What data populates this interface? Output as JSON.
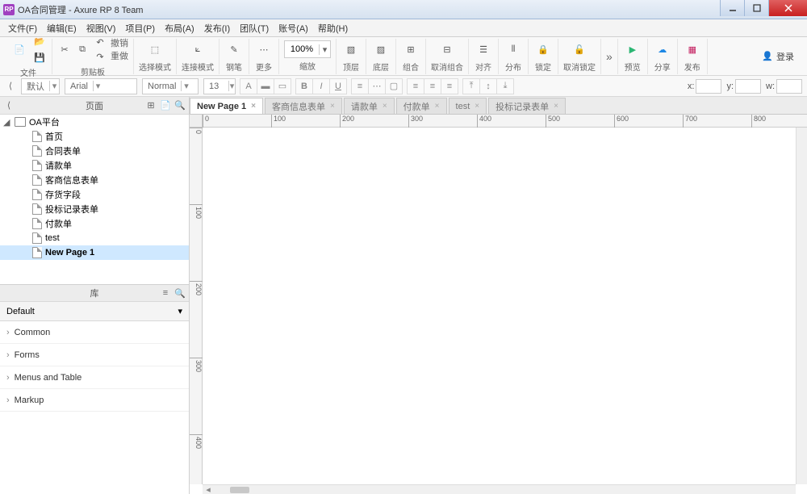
{
  "title": "OA合同管理 - Axure RP 8 Team",
  "appicon_text": "RP",
  "menu": [
    "文件(F)",
    "编辑(E)",
    "视图(V)",
    "项目(P)",
    "布局(A)",
    "发布(I)",
    "团队(T)",
    "账号(A)",
    "帮助(H)"
  ],
  "toolbar": {
    "file": "文件",
    "clipboard": "剪贴板",
    "undo": "撤销",
    "redo": "重做",
    "select_mode": "选择模式",
    "connect_mode": "连接模式",
    "pen": "钢笔",
    "more": "更多",
    "zoom": "100%",
    "scale": "缩放",
    "top": "顶层",
    "bottom": "底层",
    "group": "组合",
    "ungroup": "取消组合",
    "align": "对齐",
    "distribute": "分布",
    "lock": "锁定",
    "unlock": "取消锁定",
    "expand": "»",
    "preview": "预览",
    "share": "分享",
    "publish": "发布",
    "login": "登录"
  },
  "format": {
    "style": "默认",
    "font": "Arial",
    "weight": "Normal",
    "size": "13",
    "x": "x:",
    "y": "y:",
    "w": "w:"
  },
  "panels": {
    "pages_title": "页面",
    "lib_title": "库",
    "lib_default": "Default"
  },
  "tree": {
    "root": "OA平台",
    "items": [
      "首页",
      "合同表单",
      "请款单",
      "客商信息表单",
      "存货字段",
      "投标记录表单",
      "付款单",
      "test",
      "New Page 1"
    ],
    "selected": 8
  },
  "lib_cats": [
    "Common",
    "Forms",
    "Menus and Table",
    "Markup"
  ],
  "tabs": [
    {
      "label": "New Page 1",
      "active": true
    },
    {
      "label": "客商信息表单",
      "active": false
    },
    {
      "label": "请款单",
      "active": false
    },
    {
      "label": "付款单",
      "active": false
    },
    {
      "label": "test",
      "active": false
    },
    {
      "label": "投标记录表单",
      "active": false
    }
  ],
  "ruler_h": [
    "0",
    "100",
    "200",
    "300",
    "400",
    "500",
    "600",
    "700",
    "800"
  ],
  "ruler_v": [
    "0",
    "100",
    "200",
    "300",
    "400"
  ]
}
